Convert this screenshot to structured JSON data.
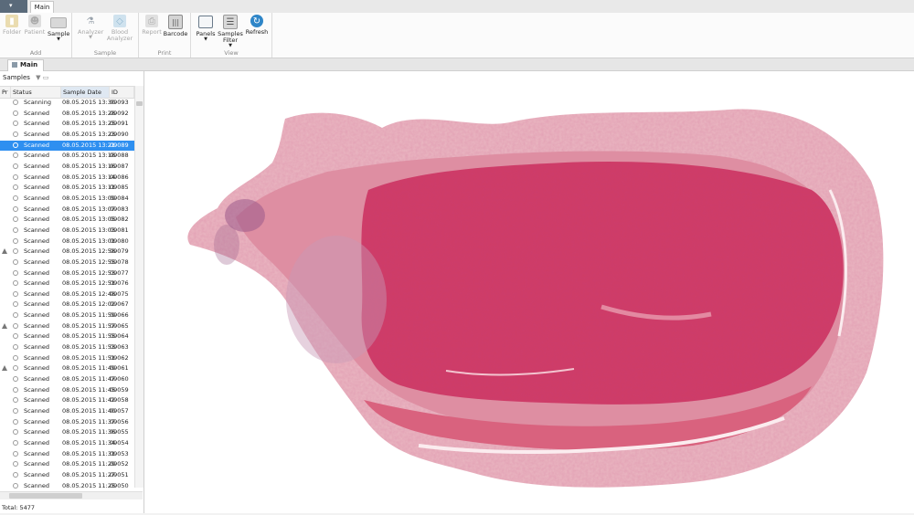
{
  "ribbon": {
    "tab": "Main",
    "groups": [
      {
        "label": "Add",
        "buttons": [
          {
            "label": "Folder",
            "icon": "folder-icon",
            "enabled": false
          },
          {
            "label": "Patient",
            "icon": "patient-icon",
            "enabled": false
          },
          {
            "label": "Sample",
            "icon": "sample-icon",
            "enabled": true
          }
        ]
      },
      {
        "label": "Sample",
        "buttons": [
          {
            "label": "Analyzer",
            "icon": "microscope-icon",
            "enabled": false
          },
          {
            "label": "Blood Analyzer",
            "icon": "blood-analyzer-icon",
            "enabled": false
          }
        ]
      },
      {
        "label": "Print",
        "buttons": [
          {
            "label": "Report",
            "icon": "printer-icon",
            "enabled": false
          },
          {
            "label": "Barcode",
            "icon": "barcode-icon",
            "enabled": true
          }
        ]
      },
      {
        "label": "View",
        "buttons": [
          {
            "label": "Panels",
            "icon": "panels-icon",
            "enabled": true
          },
          {
            "label": "Samples Filter",
            "icon": "samples-filter-icon",
            "enabled": true
          },
          {
            "label": "Refresh",
            "icon": "refresh-icon",
            "enabled": true
          }
        ]
      }
    ]
  },
  "doc_tab": "Main",
  "samples": {
    "title": "Samples",
    "columns": [
      "Pr",
      "Status",
      "Sample Date",
      "ID"
    ],
    "rows": [
      {
        "warn": false,
        "status": "Scanning",
        "date": "08.05.2015 13:30",
        "id": "09093"
      },
      {
        "warn": false,
        "status": "Scanned",
        "date": "08.05.2015 13:28",
        "id": "09092"
      },
      {
        "warn": false,
        "status": "Scanned",
        "date": "08.05.2015 13:25",
        "id": "09091"
      },
      {
        "warn": false,
        "status": "Scanned",
        "date": "08.05.2015 13:23",
        "id": "09090"
      },
      {
        "warn": false,
        "status": "Scanned",
        "date": "08.05.2015 13:21",
        "id": "09089",
        "selected": true
      },
      {
        "warn": false,
        "status": "Scanned",
        "date": "08.05.2015 13:18",
        "id": "09088"
      },
      {
        "warn": false,
        "status": "Scanned",
        "date": "08.05.2015 13:16",
        "id": "09087"
      },
      {
        "warn": false,
        "status": "Scanned",
        "date": "08.05.2015 13:14",
        "id": "09086"
      },
      {
        "warn": false,
        "status": "Scanned",
        "date": "08.05.2015 13:11",
        "id": "09085"
      },
      {
        "warn": false,
        "status": "Scanned",
        "date": "08.05.2015 13:09",
        "id": "09084"
      },
      {
        "warn": false,
        "status": "Scanned",
        "date": "08.05.2015 13:07",
        "id": "09083"
      },
      {
        "warn": false,
        "status": "Scanned",
        "date": "08.05.2015 13:05",
        "id": "09082"
      },
      {
        "warn": false,
        "status": "Scanned",
        "date": "08.05.2015 13:03",
        "id": "09081"
      },
      {
        "warn": false,
        "status": "Scanned",
        "date": "08.05.2015 13:01",
        "id": "09080"
      },
      {
        "warn": true,
        "status": "Scanned",
        "date": "08.05.2015 12:58",
        "id": "09079"
      },
      {
        "warn": false,
        "status": "Scanned",
        "date": "08.05.2015 12:55",
        "id": "09078"
      },
      {
        "warn": false,
        "status": "Scanned",
        "date": "08.05.2015 12:53",
        "id": "09077"
      },
      {
        "warn": false,
        "status": "Scanned",
        "date": "08.05.2015 12:51",
        "id": "09076"
      },
      {
        "warn": false,
        "status": "Scanned",
        "date": "08.05.2015 12:48",
        "id": "09075"
      },
      {
        "warn": false,
        "status": "Scanned",
        "date": "08.05.2015 12:02",
        "id": "09067"
      },
      {
        "warn": false,
        "status": "Scanned",
        "date": "08.05.2015 11:59",
        "id": "09066"
      },
      {
        "warn": true,
        "status": "Scanned",
        "date": "08.05.2015 11:57",
        "id": "09065"
      },
      {
        "warn": false,
        "status": "Scanned",
        "date": "08.05.2015 11:55",
        "id": "09064"
      },
      {
        "warn": false,
        "status": "Scanned",
        "date": "08.05.2015 11:53",
        "id": "09063"
      },
      {
        "warn": false,
        "status": "Scanned",
        "date": "08.05.2015 11:51",
        "id": "09062"
      },
      {
        "warn": true,
        "status": "Scanned",
        "date": "08.05.2015 11:49",
        "id": "09061"
      },
      {
        "warn": false,
        "status": "Scanned",
        "date": "08.05.2015 11:47",
        "id": "09060"
      },
      {
        "warn": false,
        "status": "Scanned",
        "date": "08.05.2015 11:45",
        "id": "09059"
      },
      {
        "warn": false,
        "status": "Scanned",
        "date": "08.05.2015 11:42",
        "id": "09058"
      },
      {
        "warn": false,
        "status": "Scanned",
        "date": "08.05.2015 11:40",
        "id": "09057"
      },
      {
        "warn": false,
        "status": "Scanned",
        "date": "08.05.2015 11:37",
        "id": "09056"
      },
      {
        "warn": false,
        "status": "Scanned",
        "date": "08.05.2015 11:36",
        "id": "09055"
      },
      {
        "warn": false,
        "status": "Scanned",
        "date": "08.05.2015 11:34",
        "id": "09054"
      },
      {
        "warn": false,
        "status": "Scanned",
        "date": "08.05.2015 11:31",
        "id": "09053"
      },
      {
        "warn": false,
        "status": "Scanned",
        "date": "08.05.2015 11:29",
        "id": "09052"
      },
      {
        "warn": false,
        "status": "Scanned",
        "date": "08.05.2015 11:27",
        "id": "09051"
      },
      {
        "warn": false,
        "status": "Scanned",
        "date": "08.05.2015 11:25",
        "id": "09050"
      }
    ],
    "total_label": "Total:",
    "total_value": "5477"
  },
  "colors": {
    "selection": "#2e8ff0",
    "tissue_light": "#e8a8b4",
    "tissue_dark": "#c8325a"
  }
}
